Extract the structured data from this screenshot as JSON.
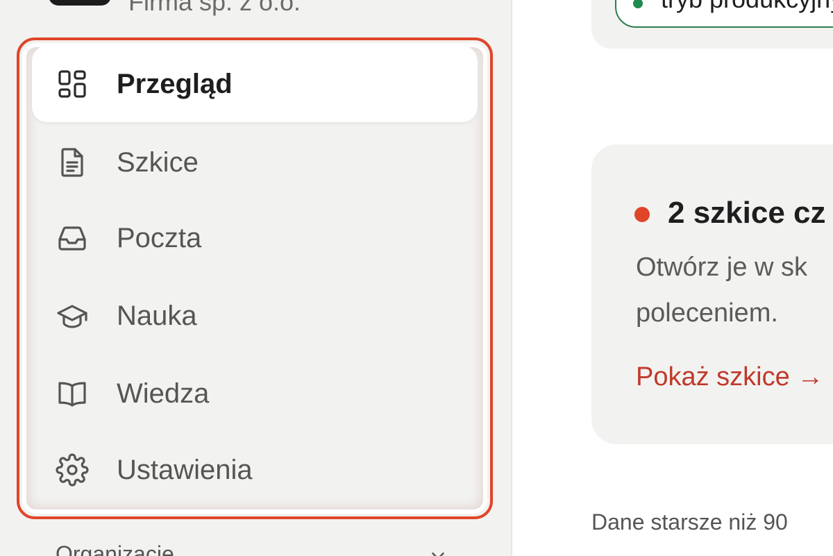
{
  "header": {
    "company_name": "Firma sp. z o.o."
  },
  "sidebar": {
    "items": [
      {
        "label": "Przegląd",
        "icon": "dashboard-icon",
        "active": true
      },
      {
        "label": "Szkice",
        "icon": "document-icon",
        "active": false
      },
      {
        "label": "Poczta",
        "icon": "inbox-icon",
        "active": false
      },
      {
        "label": "Nauka",
        "icon": "graduation-cap-icon",
        "active": false
      },
      {
        "label": "Wiedza",
        "icon": "book-icon",
        "active": false
      },
      {
        "label": "Ustawienia",
        "icon": "gear-icon",
        "active": false
      }
    ],
    "section_label": "Organizacje"
  },
  "main": {
    "mode_badge": "tryb produkcyjny",
    "drafts": {
      "title": "2 szkice cz",
      "desc_line1": "Otwórz je w sk",
      "desc_line2": "poleceniem.",
      "link": "Pokaż szkice →"
    },
    "footnote": "Dane starsze niż 90"
  },
  "colors": {
    "accent_red": "#e0452a",
    "link_red": "#c0392b",
    "status_green": "#1f8a4c",
    "sidebar_bg": "#f2f2f0"
  }
}
